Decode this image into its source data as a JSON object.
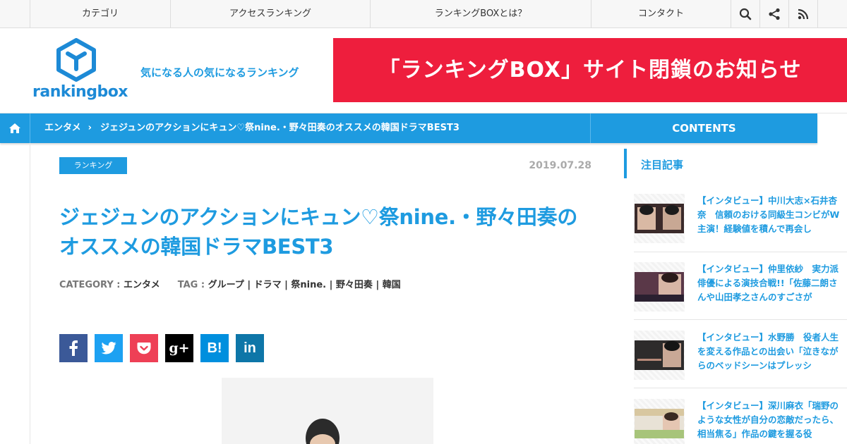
{
  "topnav": {
    "items": [
      "カテゴリ",
      "アクセスランキング",
      "ランキングBOXとは？",
      "コンタクト"
    ]
  },
  "icons": {
    "search": "search-icon",
    "share": "share-icon",
    "rss": "rss-icon",
    "home": "home-icon"
  },
  "header": {
    "logo_text": "rankingbox",
    "tagline": "気になる人の気になるランキング",
    "banner": "「ランキングBOX」サイト閉鎖のお知らせ"
  },
  "breadcrumb": {
    "category": "エンタメ",
    "current": "ジェジュンのアクションにキュン♡祭nine.・野々田奏のオススメの韓国ドラマBEST3",
    "contents_label": "CONTENTS"
  },
  "article": {
    "badge": "ランキング",
    "date": "2019.07.28",
    "title": "ジェジュンのアクションにキュン♡祭nine.・野々田奏のオススメの韓国ドラマBEST3",
    "category_label": "CATEGORY :",
    "category": "エンタメ",
    "tag_label": "TAG :",
    "tags": "グループ | ドラマ | 祭nine. | 野々田奏 | 韓国"
  },
  "social": [
    {
      "label": "f",
      "color": "#3b5998"
    },
    {
      "label": "t",
      "color": "#1da1f2"
    },
    {
      "label": "p",
      "color": "#ee4056"
    },
    {
      "label": "g+",
      "color": "#000000"
    },
    {
      "label": "B!",
      "color": "#008fde"
    },
    {
      "label": "in",
      "color": "#0e76a8"
    }
  ],
  "sidebar": {
    "heading": "注目記事",
    "items": [
      {
        "text": "【インタビュー】中川大志×石井杏奈　信頼のおける同級生コンビがW主演！経験値を積んで再会し"
      },
      {
        "text": "【インタビュー】仲里依紗　実力派俳優による演技合戦!!「佐藤二朗さんや山田孝之さんのすごさが"
      },
      {
        "text": "【インタビュー】水野勝　役者人生を変える作品との出会い「泣きながらのベッドシーンはプレッシ"
      },
      {
        "text": "【インタビュー】深川麻衣「瑞野のような女性が自分の恋敵だったら、相当焦る」作品の鍵を握る役"
      }
    ]
  },
  "colors": {
    "accent": "#1e9be0",
    "banner": "#ee1e3d"
  }
}
